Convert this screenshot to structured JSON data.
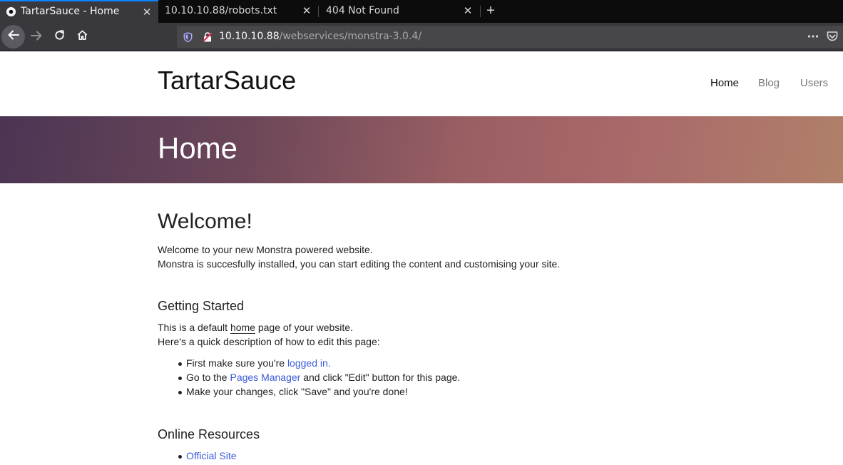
{
  "browser": {
    "tabs": [
      {
        "title": "TartarSauce - Home",
        "active": true
      },
      {
        "title": "10.10.10.88/robots.txt",
        "active": false
      },
      {
        "title": "404 Not Found",
        "active": false
      }
    ],
    "close_glyph": "✕",
    "new_tab_glyph": "+",
    "url": {
      "host": "10.10.10.88",
      "path": "/webservices/monstra-3.0.4/"
    },
    "icons": [
      "back-icon",
      "forward-icon",
      "reload-icon",
      "home-icon",
      "shield-icon",
      "insecure-lock-icon",
      "page-actions-icon",
      "pocket-icon"
    ],
    "accent_color": "#0a84ff"
  },
  "site": {
    "brand": "TartarSauce",
    "menu": {
      "home": "Home",
      "blog": "Blog",
      "users": "Users"
    },
    "hero_title": "Home"
  },
  "content": {
    "heading": "Welcome!",
    "intro_line1": "Welcome to your new Monstra powered website.",
    "intro_line2": "Monstra is succesfully installed, you can start editing the content and customising your site.",
    "getting_started": {
      "heading": "Getting Started",
      "line1_before": "This is a default ",
      "line1_link": "home",
      "line1_after": " page of your website.",
      "line2": "Here's a quick description of how to edit this page:",
      "steps": [
        {
          "before": "First make sure you're ",
          "link": "logged in.",
          "after": ""
        },
        {
          "before": "Go to the ",
          "link": "Pages Manager",
          "after": " and click \"Edit\" button for this page."
        },
        {
          "before": "Make your changes, click \"Save\" and you're done!",
          "link": "",
          "after": ""
        }
      ]
    },
    "online_resources": {
      "heading": "Online Resources",
      "links": [
        "Official Site"
      ]
    },
    "link_color": "#3b5bd9"
  }
}
